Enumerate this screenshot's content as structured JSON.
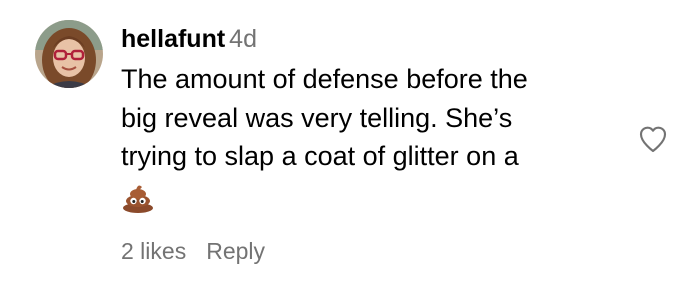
{
  "comment": {
    "username": "hellafunt",
    "timestamp": "4d",
    "lines": [
      "The amount of defense before the",
      "big reveal was very telling. She’s",
      "trying to slap a coat of glitter on a"
    ],
    "emoji": "pile-of-poo-emoji",
    "likes_label": "2 likes",
    "reply_label": "Reply"
  },
  "icons": {
    "like": "heart-outline-icon"
  },
  "colors": {
    "text": "#000000",
    "muted": "#737373",
    "emoji_brown": "#8b4a2b"
  }
}
